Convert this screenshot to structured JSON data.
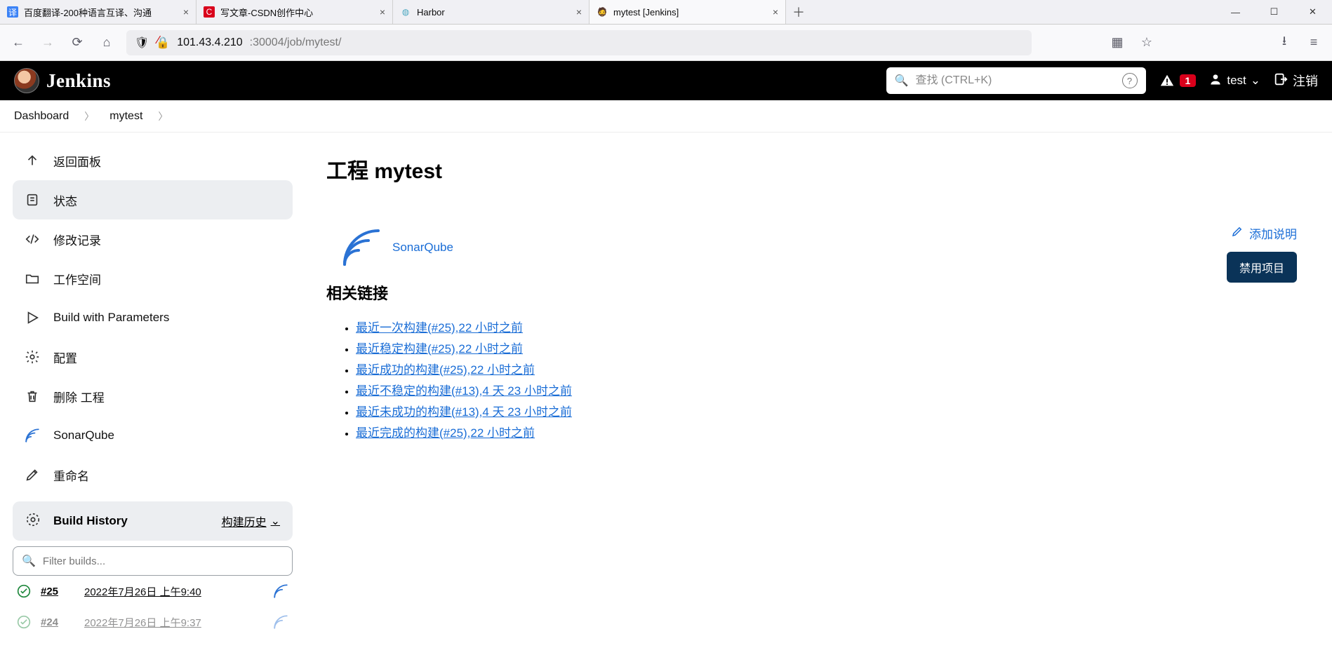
{
  "tabs": [
    {
      "label": "百度翻译-200种语言互译、沟通"
    },
    {
      "label": "写文章-CSDN创作中心"
    },
    {
      "label": "Harbor"
    },
    {
      "label": "mytest [Jenkins]"
    }
  ],
  "url": {
    "host": "101.43.4.210",
    "port_path": ":30004/job/mytest/"
  },
  "header": {
    "brand": "Jenkins",
    "search_placeholder": "查找 (CTRL+K)",
    "alerts": "1",
    "user": "test",
    "logout": "注销"
  },
  "crumbs": [
    "Dashboard",
    "mytest"
  ],
  "side": [
    {
      "k": "back",
      "label": "返回面板"
    },
    {
      "k": "status",
      "label": "状态"
    },
    {
      "k": "changes",
      "label": "修改记录"
    },
    {
      "k": "workspace",
      "label": "工作空间"
    },
    {
      "k": "build_params",
      "label": "Build with Parameters"
    },
    {
      "k": "configure",
      "label": "配置"
    },
    {
      "k": "delete",
      "label": "删除 工程"
    },
    {
      "k": "sonar",
      "label": "SonarQube"
    },
    {
      "k": "rename",
      "label": "重命名"
    }
  ],
  "bh": {
    "title": "Build History",
    "trend": "构建历史",
    "filter_placeholder": "Filter builds...",
    "rows": [
      {
        "num": "#25",
        "time": "2022年7月26日 上午9:40"
      },
      {
        "num": "#24",
        "time": "2022年7月26日 上午9:37"
      }
    ]
  },
  "main": {
    "title": "工程 mytest",
    "add_desc": "添加说明",
    "disable": "禁用项目",
    "sonar": "SonarQube",
    "related": "相关链接",
    "links": [
      "最近一次构建(#25),22 小时之前",
      "最近稳定构建(#25),22 小时之前",
      "最近成功的构建(#25),22 小时之前",
      "最近不稳定的构建(#13),4 天 23 小时之前",
      "最近未成功的构建(#13),4 天 23 小时之前",
      "最近完成的构建(#25),22 小时之前"
    ]
  }
}
